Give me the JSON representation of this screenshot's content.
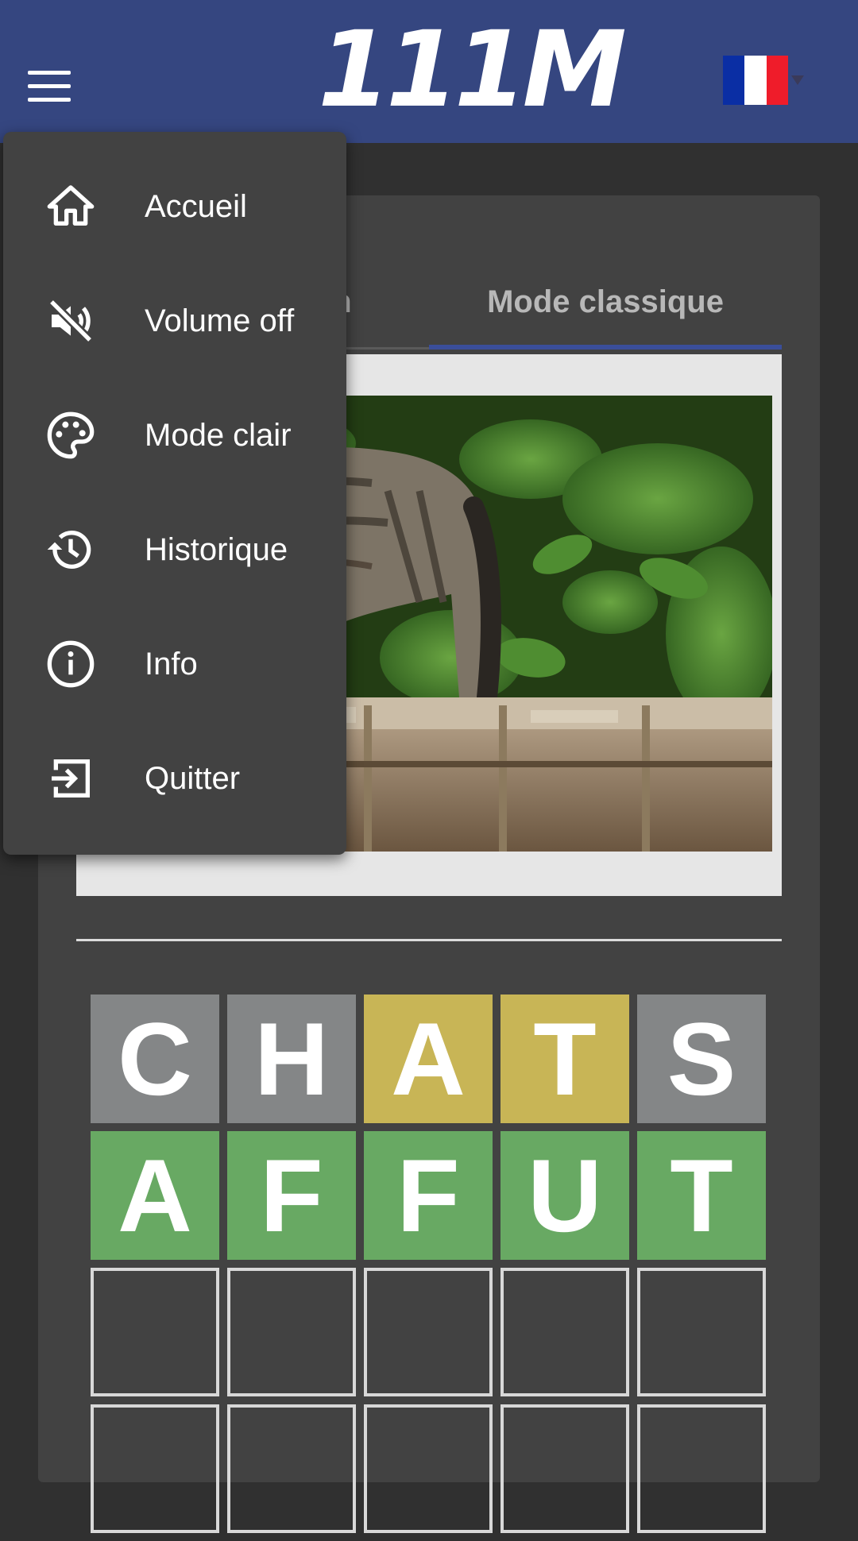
{
  "header": {
    "logo_text": "111M",
    "language": "FR",
    "colors": {
      "background": "#354680"
    }
  },
  "tabs": [
    {
      "label": "Mode quotidien",
      "visible_label": "en"
    },
    {
      "label": "Mode classique",
      "active": true
    }
  ],
  "menu": {
    "items": [
      {
        "label": "Accueil",
        "icon": "home-icon"
      },
      {
        "label": "Volume off",
        "icon": "volume-off-icon"
      },
      {
        "label": "Mode clair",
        "icon": "palette-icon"
      },
      {
        "label": "Historique",
        "icon": "history-icon"
      },
      {
        "label": "Info",
        "icon": "info-icon"
      },
      {
        "label": "Quitter",
        "icon": "exit-icon"
      }
    ]
  },
  "game": {
    "rows": [
      [
        {
          "letter": "C",
          "state": "absent"
        },
        {
          "letter": "H",
          "state": "absent"
        },
        {
          "letter": "A",
          "state": "present"
        },
        {
          "letter": "T",
          "state": "present"
        },
        {
          "letter": "S",
          "state": "absent"
        }
      ],
      [
        {
          "letter": "A",
          "state": "correct"
        },
        {
          "letter": "F",
          "state": "correct"
        },
        {
          "letter": "F",
          "state": "correct"
        },
        {
          "letter": "U",
          "state": "correct"
        },
        {
          "letter": "T",
          "state": "correct"
        }
      ]
    ],
    "colors": {
      "absent": "#848687",
      "present": "#c8b556",
      "correct": "#68a963"
    }
  }
}
